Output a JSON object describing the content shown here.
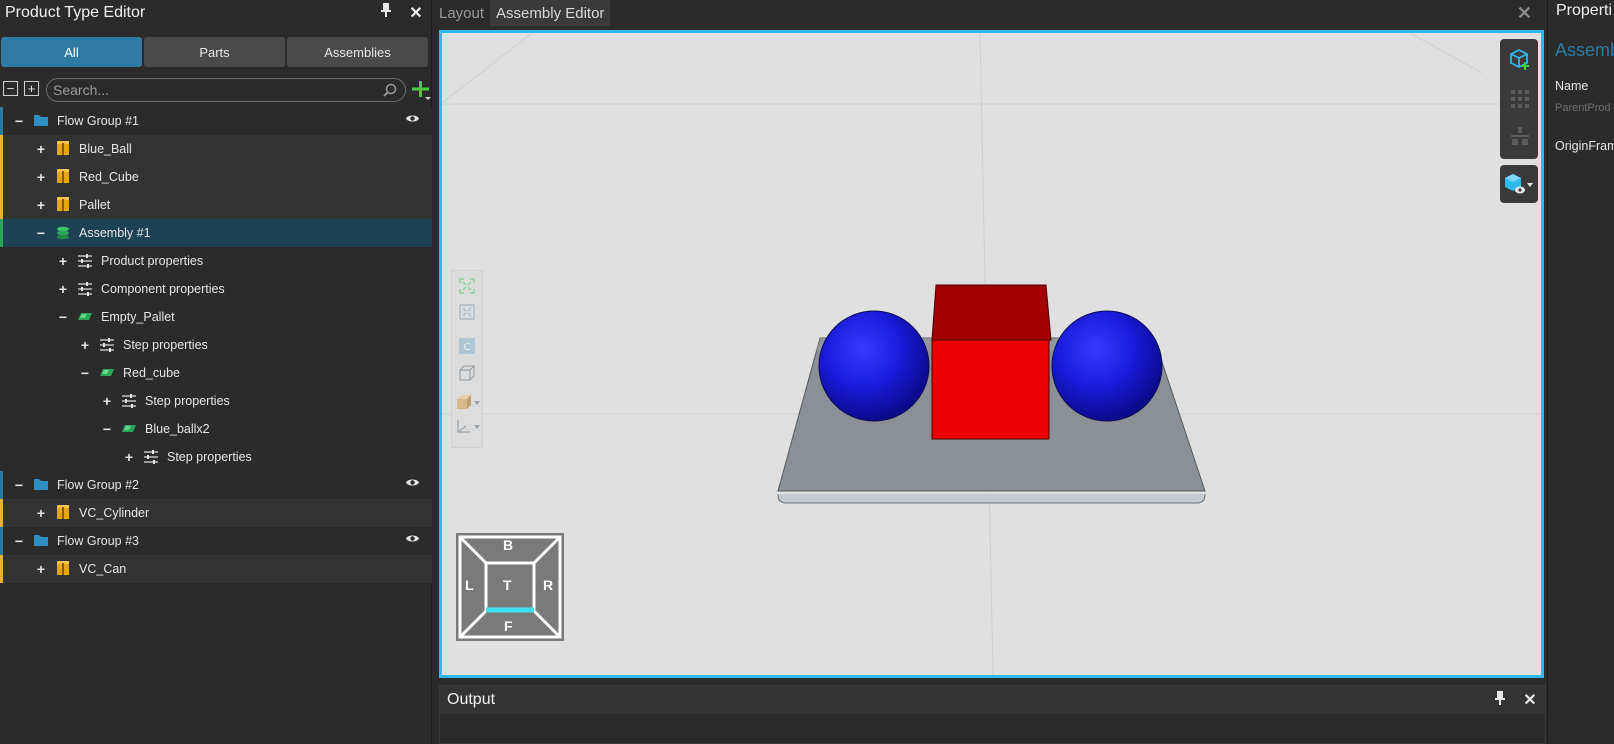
{
  "left_panel": {
    "title": "Product Type Editor",
    "filter_tabs": [
      {
        "label": "All",
        "active": true
      },
      {
        "label": "Parts",
        "active": false
      },
      {
        "label": "Assemblies",
        "active": false
      }
    ],
    "search_placeholder": "Search...",
    "tree": [
      {
        "label": "Flow Group #1",
        "type": "group",
        "toggle": "−",
        "eye": true
      },
      {
        "label": "Blue_Ball",
        "type": "part",
        "toggle": "+"
      },
      {
        "label": "Red_Cube",
        "type": "part",
        "toggle": "+"
      },
      {
        "label": "Pallet",
        "type": "part",
        "toggle": "+"
      },
      {
        "label": "Assembly #1",
        "type": "assembly",
        "toggle": "−",
        "selected": true
      },
      {
        "label": "Product properties",
        "type": "properties",
        "toggle": "+"
      },
      {
        "label": "Component properties",
        "type": "properties",
        "toggle": "+"
      },
      {
        "label": "Empty_Pallet",
        "type": "step",
        "toggle": "−"
      },
      {
        "label": "Step properties",
        "type": "properties",
        "toggle": "+"
      },
      {
        "label": "Red_cube",
        "type": "step",
        "toggle": "−"
      },
      {
        "label": "Step properties",
        "type": "properties",
        "toggle": "+"
      },
      {
        "label": "Blue_ballx2",
        "type": "step",
        "toggle": "−"
      },
      {
        "label": "Step properties",
        "type": "properties",
        "toggle": "+"
      },
      {
        "label": "Flow Group #2",
        "type": "group",
        "toggle": "−",
        "eye": true
      },
      {
        "label": "VC_Cylinder",
        "type": "part",
        "toggle": "+"
      },
      {
        "label": "Flow Group #3",
        "type": "group",
        "toggle": "−",
        "eye": true
      },
      {
        "label": "VC_Can",
        "type": "part",
        "toggle": "+"
      }
    ]
  },
  "center": {
    "tabs": [
      {
        "label": "Layout",
        "active": false
      },
      {
        "label": "Assembly Editor",
        "active": true
      }
    ],
    "view_cube": {
      "top": "B",
      "left": "L",
      "center": "T",
      "right": "R",
      "bottom": "F"
    },
    "output_title": "Output"
  },
  "right_panel": {
    "title": "Properti",
    "object_name": "Assemb",
    "name_label": "Name",
    "name_value": "ParentProd",
    "origin_label": "OriginFram"
  },
  "colors": {
    "accent_blue": "#2e7aa3",
    "viewport_border": "#2fb8ea",
    "part_bar": "#e6b32e",
    "assembly_bar": "#2ea35a",
    "group_bar": "#2e7aa3"
  }
}
